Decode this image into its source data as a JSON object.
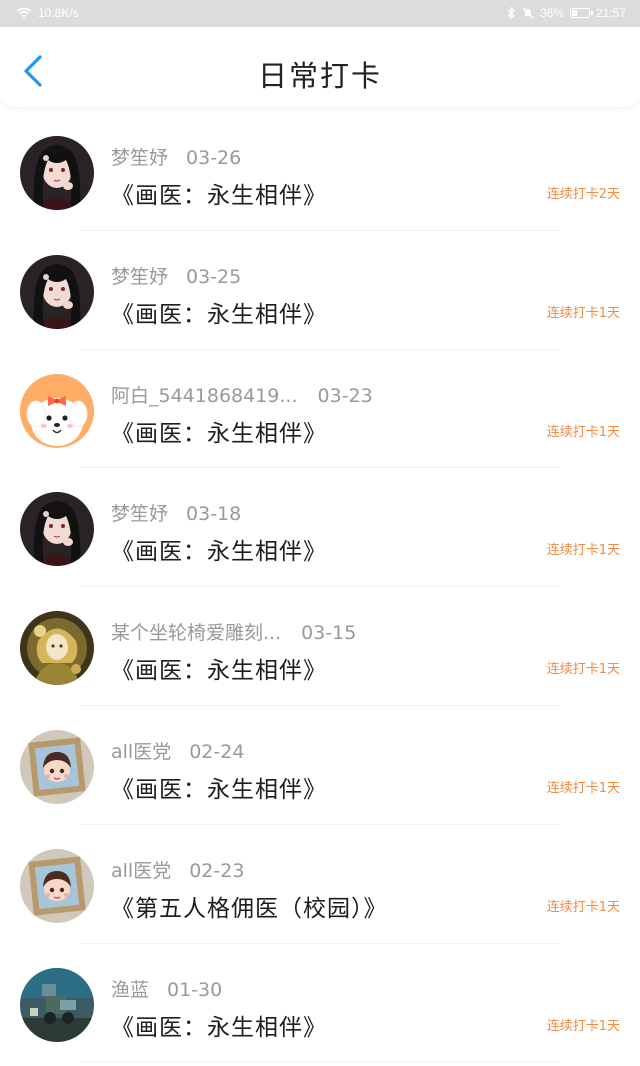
{
  "status_bar": {
    "network_speed": "10.8K/s",
    "battery": "36%",
    "battery_level": 0.36,
    "time": "21:57"
  },
  "header": {
    "title": "日常打卡"
  },
  "colors": {
    "accent": "#2196f3",
    "streak": "#ef8b43",
    "meta": "#999999"
  },
  "checkins": [
    {
      "user": "梦笙妤",
      "date": "03-26",
      "book": "《画医：永生相伴》",
      "streak": "连续打卡2天",
      "avatar": "dark-hair-girl"
    },
    {
      "user": "梦笙妤",
      "date": "03-25",
      "book": "《画医：永生相伴》",
      "streak": "连续打卡1天",
      "avatar": "dark-hair-girl"
    },
    {
      "user": "阿白_5441868419...",
      "date": "03-23",
      "book": "《画医：永生相伴》",
      "streak": "连续打卡1天",
      "avatar": "white-puppy"
    },
    {
      "user": "梦笙妤",
      "date": "03-18",
      "book": "《画医：永生相伴》",
      "streak": "连续打卡1天",
      "avatar": "dark-hair-girl"
    },
    {
      "user": "某个坐轮椅爱雕刻...",
      "date": "03-15",
      "book": "《画医：永生相伴》",
      "streak": "连续打卡1天",
      "avatar": "golden-doll"
    },
    {
      "user": "all医党",
      "date": "02-24",
      "book": "《画医：永生相伴》",
      "streak": "连续打卡1天",
      "avatar": "framed-chibi"
    },
    {
      "user": "all医党",
      "date": "02-23",
      "book": "《第五人格佣医（校园）》",
      "streak": "连续打卡1天",
      "avatar": "framed-chibi"
    },
    {
      "user": "渔蓝",
      "date": "01-30",
      "book": "《画医：永生相伴》",
      "streak": "连续打卡1天",
      "avatar": "robot-scene"
    }
  ]
}
